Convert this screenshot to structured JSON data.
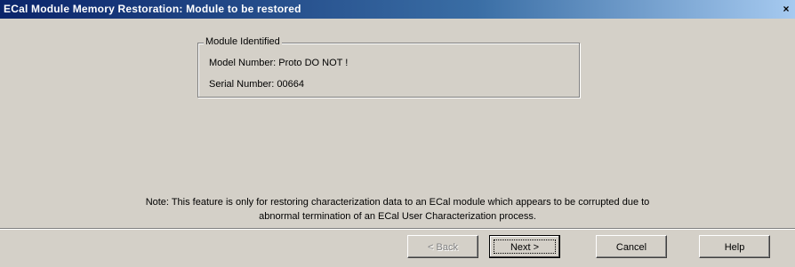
{
  "window": {
    "title": "ECal Module Memory Restoration: Module to be restored",
    "close_glyph": "×"
  },
  "module_group": {
    "title": "Module Identified",
    "model_line": "Model Number:  Proto DO NOT !",
    "serial_line": "Serial Number:  00664"
  },
  "note": {
    "line1": "Note:  This feature is only for restoring characterization data to an ECal module which appears to be corrupted due to",
    "line2": "abnormal termination of an ECal User Characterization process."
  },
  "buttons": {
    "back": "< Back",
    "next": "Next >",
    "cancel": "Cancel",
    "help": "Help"
  }
}
